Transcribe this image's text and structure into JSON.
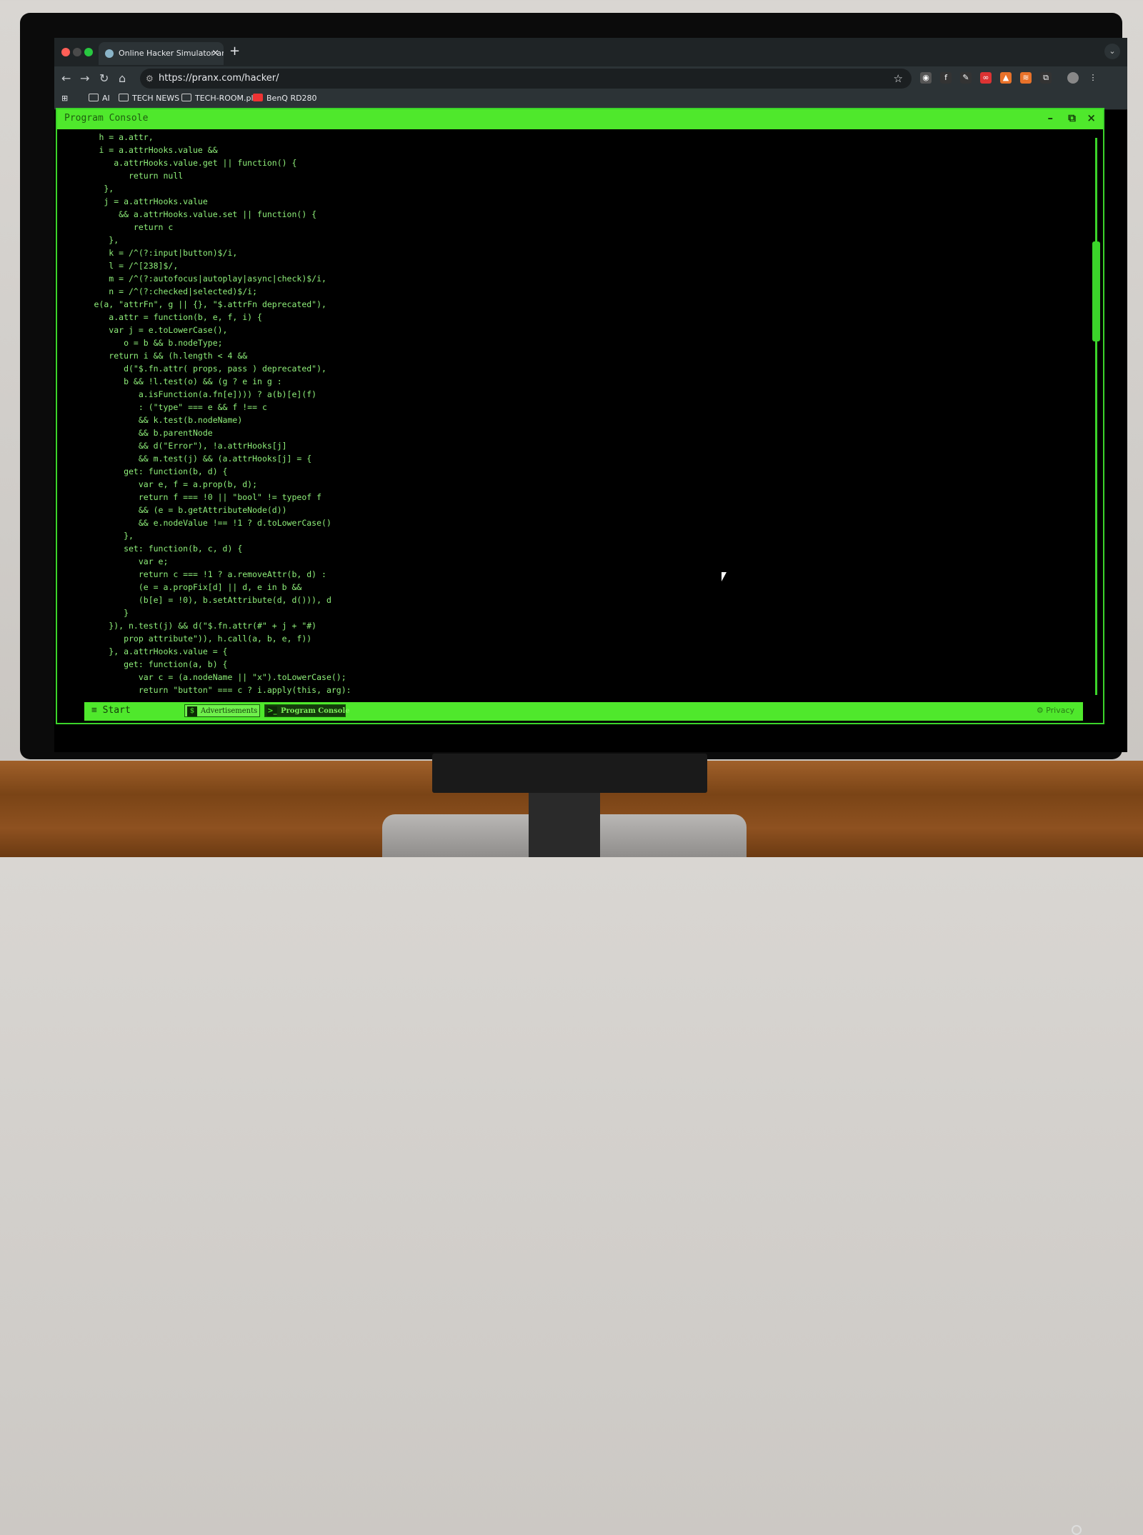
{
  "browser": {
    "tab_title": "Online Hacker Simulator and",
    "tab_close": "×",
    "new_tab": "+",
    "url": "https://pranx.com/hacker/",
    "bookmarks": [
      "AI",
      "TECH NEWS",
      "TECH-ROOM.pl",
      "BenQ RD280"
    ]
  },
  "console": {
    "title": "Program Console",
    "minimize": "–",
    "maximize": "⧉",
    "close": "×",
    "code_lines": [
      "       h = a.attr,",
      "       i = a.attrHooks.value &&",
      "          a.attrHooks.value.get || function() {",
      "             return null",
      "        },",
      "        j = a.attrHooks.value",
      "           && a.attrHooks.value.set || function() {",
      "              return c",
      "         },",
      "         k = /^(?:input|button)$/i,",
      "         l = /^[238]$/,",
      "         m = /^(?:autofocus|autoplay|async|check)$/i,",
      "         n = /^(?:checked|selected)$/i;",
      "      e(a, \"attrFn\", g || {}, \"$.attrFn deprecated\"),",
      "         a.attr = function(b, e, f, i) {",
      "         var j = e.toLowerCase(),",
      "            o = b && b.nodeType;",
      "         return i && (h.length < 4 &&",
      "            d(\"$.fn.attr( props, pass ) deprecated\"),",
      "            b && !l.test(o) && (g ? e in g :",
      "               a.isFunction(a.fn[e]))) ? a(b)[e](f)",
      "               : (\"type\" === e && f !== c",
      "               && k.test(b.nodeName)",
      "               && b.parentNode",
      "               && d(\"Error\"), !a.attrHooks[j]",
      "               && m.test(j) && (a.attrHooks[j] = {",
      "            get: function(b, d) {",
      "               var e, f = a.prop(b, d);",
      "               return f === !0 || \"bool\" != typeof f",
      "               && (e = b.getAttributeNode(d))",
      "               && e.nodeValue !== !1 ? d.toLowerCase()",
      "            },",
      "            set: function(b, c, d) {",
      "               var e;",
      "               return c === !1 ? a.removeAttr(b, d) :",
      "               (e = a.propFix[d] || d, e in b &&",
      "               (b[e] = !0), b.setAttribute(d, d())), d",
      "            }",
      "         }), n.test(j) && d(\"$.fn.attr(#\" + j + \"#)",
      "            prop attribute\")), h.call(a, b, e, f))",
      "         }, a.attrHooks.value = {",
      "            get: function(a, b) {",
      "               var c = (a.nodeName || \"x\").toLowerCase();",
      "               return \"button\" === c ? i.apply(this, arg):"
    ]
  },
  "taskbar": {
    "start_label": "≡  Start",
    "tasks": [
      {
        "label": "Advertisements",
        "icon": "$"
      },
      {
        "label": "Program Console",
        "icon": ">_"
      }
    ],
    "privacy_label": "Privacy"
  },
  "colors": {
    "accent_green": "#4fe82c",
    "code_green": "#8ff07a",
    "background": "#000000"
  }
}
